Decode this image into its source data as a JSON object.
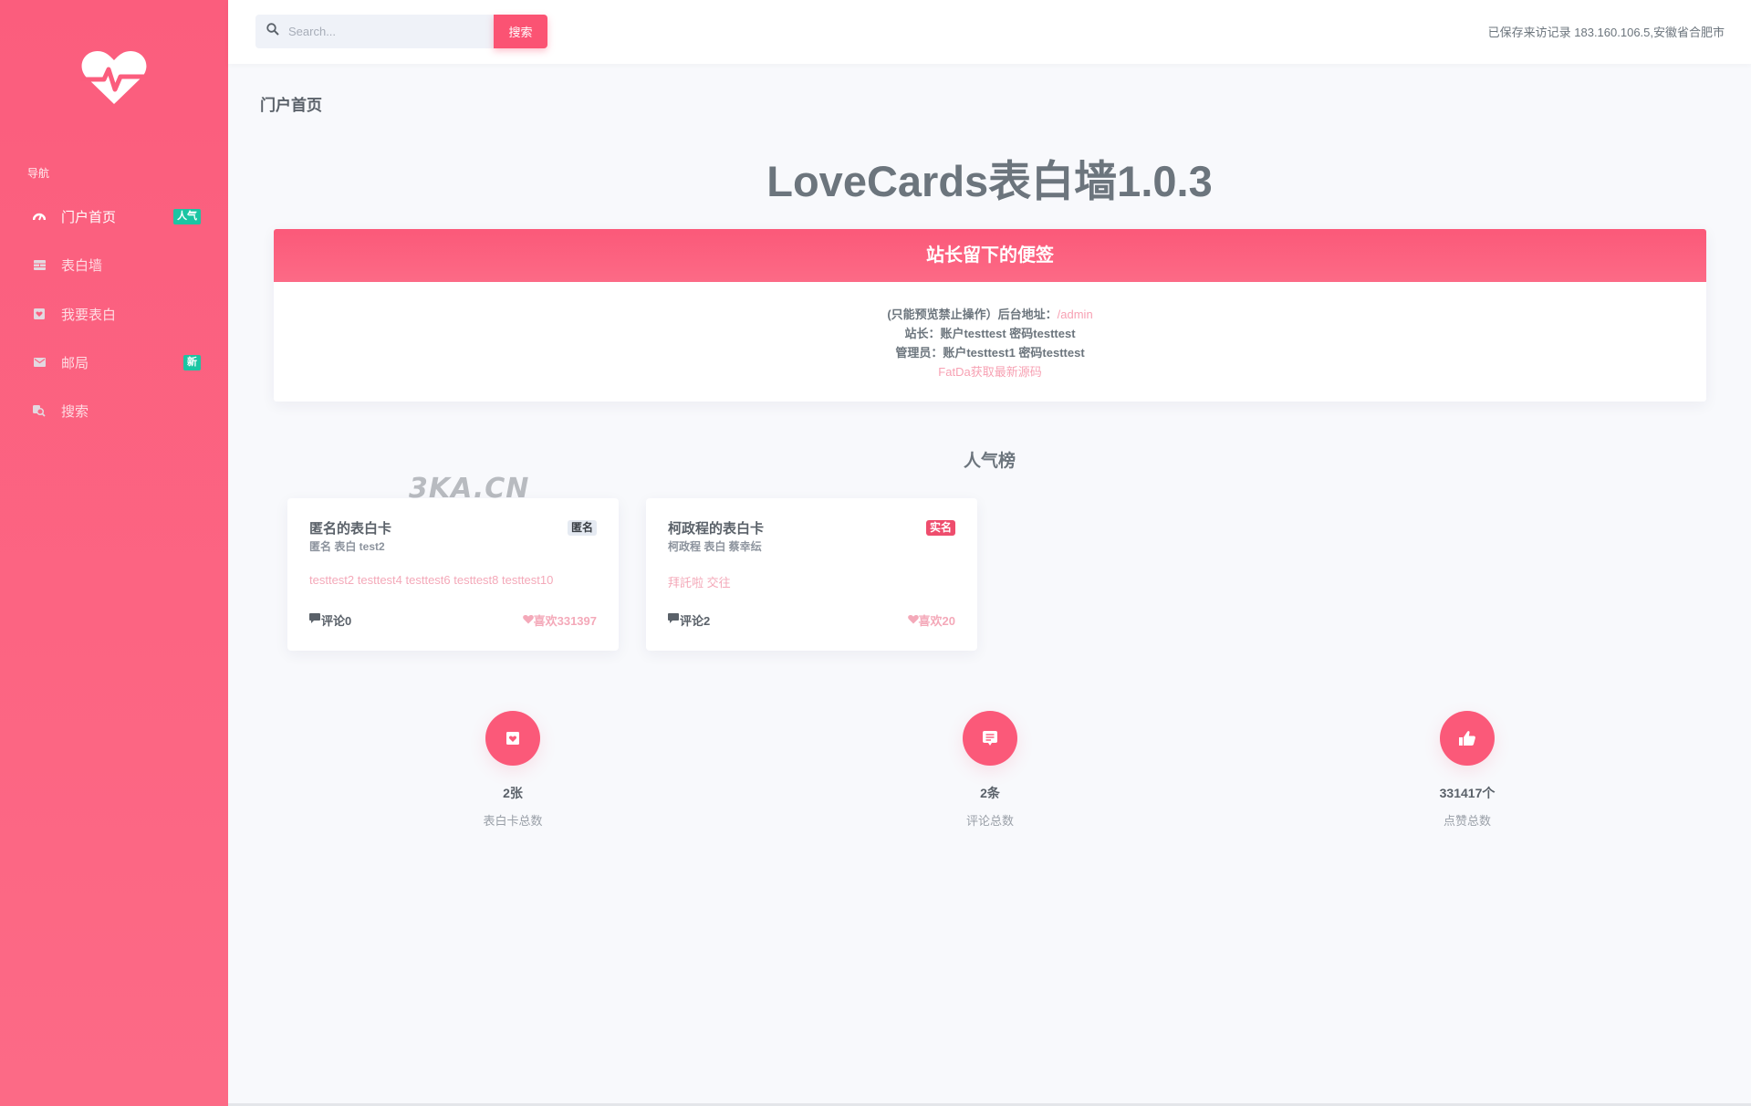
{
  "sidebar": {
    "logo_icon": "heartbeat-icon",
    "nav_title": "导航",
    "items": [
      {
        "label": "门户首页",
        "icon": "dashboard-gauge-icon",
        "badge": "人气",
        "active": true
      },
      {
        "label": "表白墙",
        "icon": "wall-icon",
        "badge": null,
        "active": false
      },
      {
        "label": "我要表白",
        "icon": "heart-card-icon",
        "badge": null,
        "active": false
      },
      {
        "label": "邮局",
        "icon": "envelope-icon",
        "badge": "新",
        "active": false
      },
      {
        "label": "搜索",
        "icon": "search-icon",
        "badge": null,
        "active": false
      }
    ]
  },
  "header": {
    "search_placeholder": "Search...",
    "search_value": "",
    "search_button": "搜索",
    "visit_record": "已保存来访记录 183.160.106.5,安徽省合肥市"
  },
  "main": {
    "page_title": "门户首页",
    "site_title": "LoveCards表白墙1.0.3",
    "note": {
      "title": "站长留下的便签",
      "line1_prefix": "(只能预览禁止操作）后台地址：",
      "line1_link": "/admin",
      "line2": "站长：账户testtest 密码testtest",
      "line3": "管理员：账户testtest1 密码testtest",
      "line4_link": "FatDa获取最新源码"
    },
    "rank_title": "人气榜",
    "watermark": "3KA.CN",
    "cards": [
      {
        "title": "匿名的表白卡",
        "subtitle": "匿名 表白 test2",
        "tag": "匿名",
        "tag_type": "anon",
        "content": "testtest2 testtest4 testtest6 testtest8 testtest10",
        "comments": "评论0",
        "likes": "喜欢331397"
      },
      {
        "title": "柯政程的表白卡",
        "subtitle": "柯政程 表白 蔡幸纭",
        "tag": "实名",
        "tag_type": "real",
        "content": "拜託啦 交往",
        "comments": "评论2",
        "likes": "喜欢20"
      }
    ],
    "stats": [
      {
        "icon": "heart-card-icon",
        "value": "2张",
        "label": "表白卡总数"
      },
      {
        "icon": "comment-icon",
        "value": "2条",
        "label": "评论总数"
      },
      {
        "icon": "thumbs-up-icon",
        "value": "331417个",
        "label": "点赞总数"
      }
    ]
  },
  "colors": {
    "brand_pink": "#fb5979",
    "badge_green": "#1bc5a3",
    "text_gray": "#6c757d",
    "soft_pink": "#f4a9b9",
    "background": "#f8f9fc"
  }
}
